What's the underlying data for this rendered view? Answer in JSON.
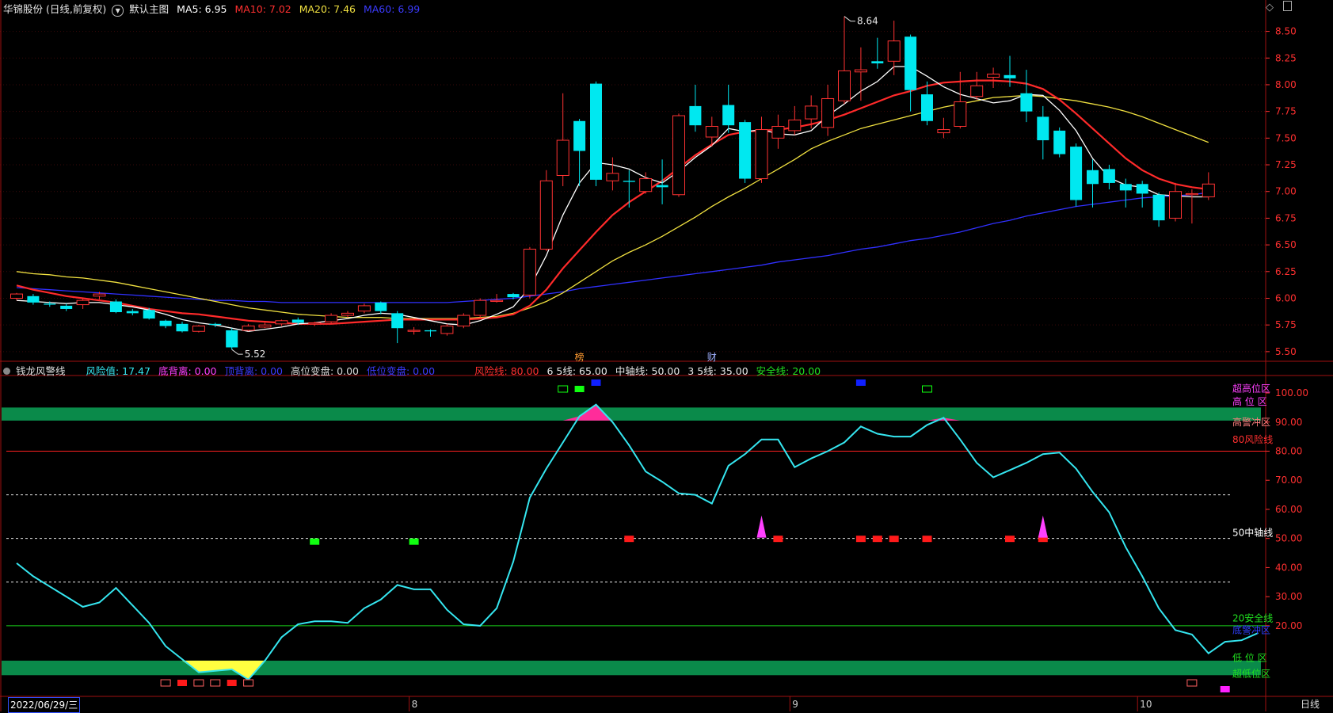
{
  "main_header": {
    "stock": "华锦股份 (日线,前复权)",
    "icon": "chevron-down-icon",
    "template": "默认主图",
    "ma5": "MA5: 6.95",
    "ma10": "MA10: 7.02",
    "ma20": "MA20: 7.46",
    "ma60": "MA60: 6.99",
    "ma_colors": {
      "ma5": "#ffffff",
      "ma10": "#ff2a2a",
      "ma20": "#f0e040",
      "ma60": "#3030ff"
    }
  },
  "window_icons": [
    "diamond-icon",
    "maximize-icon"
  ],
  "indicator_header": {
    "name": "钱龙风警线",
    "risk": "风险值: 17.47",
    "bottom_gap": "底背离: 0.00",
    "top_gap": "顶背离: 0.00",
    "high_turn": "高位变盘: 0.00",
    "low_turn": "低位变盘: 0.00",
    "risk_line": "风险线: 80.00",
    "line65": "6 5线: 65.00",
    "mid_line": "中轴线: 50.00",
    "line35": "3 5线: 35.00",
    "safe_line": "安全线: 20.00"
  },
  "colors": {
    "up": "#ff3232",
    "down": "#00e8f0",
    "risk_curve": "#35e6f0",
    "band": "#0a8a4a",
    "risk_red": "#ff2020",
    "safe_green": "#18d018",
    "axis_red": "#ff3030",
    "pink_fill": "#ff2c9a",
    "yellow_fill": "#ffff40"
  },
  "markers": {
    "bang": "榜",
    "cai": "财"
  },
  "bottom_bar": {
    "date": "2022/06/29/三",
    "period": "日线"
  },
  "zone_labels": [
    {
      "text": "超高位区",
      "color": "#ff40ff",
      "y": 101.5
    },
    {
      "text": "高 位 区",
      "color": "#ff40ff",
      "y": 97
    },
    {
      "text": "高警冲区",
      "color": "#ff8080",
      "y": 90
    },
    {
      "text": "80风险线",
      "color": "#ff3030",
      "y": 84
    },
    {
      "text": "50中轴线",
      "color": "#ffffff",
      "y": 52
    },
    {
      "text": "20安全线",
      "color": "#20e020",
      "y": 22.5
    },
    {
      "text": "底警冲区",
      "color": "#3040ff",
      "y": 18.5
    },
    {
      "text": "低 位 区",
      "color": "#20e020",
      "y": 9
    },
    {
      "text": "超低位区",
      "color": "#20e020",
      "y": 3.5
    }
  ],
  "chart_data": [
    {
      "type": "candlestick",
      "title": "华锦股份 (日线,前复权)",
      "price_ticks": [
        "8.50",
        "8.25",
        "8.00",
        "7.75",
        "7.50",
        "7.25",
        "7.00",
        "6.75",
        "6.50",
        "6.25",
        "6.00",
        "5.75",
        "5.50"
      ],
      "ylim": [
        5.41,
        8.66
      ],
      "month_ticks": [
        {
          "label": "8",
          "index": 24
        },
        {
          "label": "9",
          "index": 47
        },
        {
          "label": "10",
          "index": 68
        }
      ],
      "annotations": {
        "high": "8.64",
        "low": "5.52"
      },
      "candles": [
        [
          6.0,
          6.04,
          5.98,
          6.05
        ],
        [
          6.02,
          5.96,
          5.94,
          6.04
        ],
        [
          5.95,
          5.94,
          5.92,
          5.97
        ],
        [
          5.93,
          5.9,
          5.88,
          5.95
        ],
        [
          5.94,
          5.98,
          5.9,
          6.0
        ],
        [
          6.02,
          6.04,
          5.99,
          6.06
        ],
        [
          5.97,
          5.87,
          5.86,
          5.99
        ],
        [
          5.88,
          5.86,
          5.84,
          5.9
        ],
        [
          5.89,
          5.81,
          5.8,
          5.91
        ],
        [
          5.79,
          5.74,
          5.72,
          5.8
        ],
        [
          5.76,
          5.69,
          5.68,
          5.78
        ],
        [
          5.69,
          5.74,
          5.68,
          5.75
        ],
        [
          5.76,
          5.75,
          5.73,
          5.77
        ],
        [
          5.7,
          5.54,
          5.52,
          5.72
        ],
        [
          5.7,
          5.74,
          5.69,
          5.76
        ],
        [
          5.73,
          5.75,
          5.72,
          5.77
        ],
        [
          5.76,
          5.79,
          5.74,
          5.8
        ],
        [
          5.8,
          5.77,
          5.75,
          5.82
        ],
        [
          5.76,
          5.77,
          5.74,
          5.78
        ],
        [
          5.78,
          5.84,
          5.76,
          5.86
        ],
        [
          5.84,
          5.86,
          5.82,
          5.88
        ],
        [
          5.88,
          5.93,
          5.86,
          5.95
        ],
        [
          5.96,
          5.88,
          5.85,
          5.97
        ],
        [
          5.86,
          5.72,
          5.58,
          5.88
        ],
        [
          5.69,
          5.7,
          5.66,
          5.73
        ],
        [
          5.7,
          5.69,
          5.64,
          5.71
        ],
        [
          5.67,
          5.74,
          5.65,
          5.76
        ],
        [
          5.74,
          5.84,
          5.72,
          5.86
        ],
        [
          5.84,
          5.98,
          5.82,
          6.0
        ],
        [
          5.97,
          5.98,
          5.96,
          6.04
        ],
        [
          6.04,
          6.01,
          5.99,
          6.05
        ],
        [
          6.03,
          6.46,
          6.0,
          6.48
        ],
        [
          6.46,
          7.1,
          6.44,
          7.2
        ],
        [
          7.15,
          7.48,
          7.05,
          7.92
        ],
        [
          7.66,
          7.38,
          7.05,
          7.68
        ],
        [
          8.01,
          7.11,
          7.05,
          8.03
        ],
        [
          7.1,
          7.17,
          7.01,
          7.32
        ],
        [
          7.1,
          7.09,
          6.85,
          7.2
        ],
        [
          7.0,
          7.12,
          6.98,
          7.18
        ],
        [
          7.06,
          7.04,
          6.88,
          7.3
        ],
        [
          6.97,
          7.71,
          6.95,
          7.73
        ],
        [
          7.8,
          7.62,
          7.56,
          8.0
        ],
        [
          7.51,
          7.61,
          7.42,
          7.7
        ],
        [
          7.81,
          7.62,
          7.55,
          8.0
        ],
        [
          7.65,
          7.12,
          7.08,
          7.67
        ],
        [
          7.12,
          7.58,
          7.08,
          7.7
        ],
        [
          7.5,
          7.61,
          7.4,
          7.72
        ],
        [
          7.57,
          7.67,
          7.53,
          7.8
        ],
        [
          7.68,
          7.8,
          7.59,
          7.9
        ],
        [
          7.6,
          7.87,
          7.52,
          8.0
        ],
        [
          7.85,
          8.13,
          7.82,
          8.64
        ],
        [
          8.12,
          8.14,
          7.85,
          8.35
        ],
        [
          8.22,
          8.2,
          8.15,
          8.44
        ],
        [
          8.22,
          8.41,
          8.09,
          8.6
        ],
        [
          8.45,
          7.95,
          7.75,
          8.47
        ],
        [
          7.91,
          7.66,
          7.62,
          8.03
        ],
        [
          7.55,
          7.58,
          7.5,
          7.69
        ],
        [
          7.61,
          7.84,
          7.59,
          8.12
        ],
        [
          7.89,
          7.99,
          7.86,
          8.12
        ],
        [
          8.07,
          8.1,
          7.97,
          8.16
        ],
        [
          8.09,
          8.06,
          7.98,
          8.27
        ],
        [
          7.92,
          7.75,
          7.65,
          8.14
        ],
        [
          7.7,
          7.48,
          7.3,
          7.8
        ],
        [
          7.57,
          7.35,
          7.32,
          7.6
        ],
        [
          7.42,
          6.92,
          6.86,
          7.45
        ],
        [
          7.2,
          7.07,
          6.85,
          7.3
        ],
        [
          7.21,
          7.08,
          7.02,
          7.25
        ],
        [
          7.07,
          7.01,
          6.85,
          7.12
        ],
        [
          7.07,
          6.98,
          6.85,
          7.1
        ],
        [
          6.97,
          6.73,
          6.67,
          6.99
        ],
        [
          6.75,
          7.0,
          6.72,
          7.08
        ],
        [
          6.97,
          6.98,
          6.7,
          7.02
        ],
        [
          6.95,
          7.07,
          6.92,
          7.18
        ]
      ],
      "series": [
        {
          "name": "MA5",
          "values": [
            5.98,
            5.97,
            5.96,
            5.95,
            5.96,
            5.96,
            5.94,
            5.92,
            5.89,
            5.85,
            5.8,
            5.77,
            5.75,
            5.72,
            5.69,
            5.71,
            5.73,
            5.76,
            5.77,
            5.79,
            5.81,
            5.84,
            5.86,
            5.85,
            5.82,
            5.79,
            5.76,
            5.75,
            5.79,
            5.85,
            5.92,
            6.1,
            6.4,
            6.78,
            7.08,
            7.27,
            7.25,
            7.21,
            7.13,
            7.08,
            7.19,
            7.32,
            7.43,
            7.59,
            7.56,
            7.58,
            7.54,
            7.53,
            7.57,
            7.71,
            7.82,
            7.94,
            8.03,
            8.17,
            8.17,
            8.08,
            7.98,
            7.91,
            7.87,
            7.83,
            7.85,
            7.91,
            7.9,
            7.76,
            7.57,
            7.31,
            7.13,
            7.06,
            7.04,
            6.97,
            6.96,
            6.95,
            6.95
          ]
        },
        {
          "name": "MA10",
          "values": [
            6.12,
            6.08,
            6.05,
            6.02,
            6.0,
            5.98,
            5.96,
            5.93,
            5.9,
            5.88,
            5.86,
            5.85,
            5.83,
            5.81,
            5.79,
            5.78,
            5.77,
            5.76,
            5.76,
            5.76,
            5.77,
            5.78,
            5.79,
            5.8,
            5.8,
            5.8,
            5.8,
            5.8,
            5.81,
            5.82,
            5.85,
            5.93,
            6.08,
            6.28,
            6.45,
            6.62,
            6.78,
            6.9,
            7.0,
            7.1,
            7.22,
            7.34,
            7.44,
            7.53,
            7.56,
            7.57,
            7.58,
            7.6,
            7.63,
            7.67,
            7.72,
            7.78,
            7.84,
            7.9,
            7.94,
            7.99,
            8.02,
            8.03,
            8.04,
            8.04,
            8.03,
            8.01,
            7.96,
            7.86,
            7.73,
            7.59,
            7.45,
            7.31,
            7.2,
            7.12,
            7.07,
            7.04,
            7.02
          ]
        },
        {
          "name": "MA20",
          "values": [
            6.25,
            6.23,
            6.22,
            6.2,
            6.19,
            6.17,
            6.15,
            6.12,
            6.09,
            6.06,
            6.03,
            6.0,
            5.97,
            5.94,
            5.91,
            5.89,
            5.87,
            5.85,
            5.84,
            5.83,
            5.82,
            5.82,
            5.82,
            5.81,
            5.81,
            5.81,
            5.81,
            5.81,
            5.82,
            5.83,
            5.86,
            5.91,
            5.97,
            6.05,
            6.15,
            6.25,
            6.35,
            6.43,
            6.5,
            6.58,
            6.67,
            6.76,
            6.86,
            6.95,
            7.03,
            7.12,
            7.21,
            7.3,
            7.4,
            7.47,
            7.53,
            7.59,
            7.63,
            7.67,
            7.71,
            7.75,
            7.79,
            7.82,
            7.85,
            7.88,
            7.89,
            7.9,
            7.89,
            7.87,
            7.85,
            7.82,
            7.79,
            7.75,
            7.7,
            7.64,
            7.58,
            7.52,
            7.46
          ]
        },
        {
          "name": "MA60",
          "values": [
            6.1,
            6.09,
            6.08,
            6.07,
            6.06,
            6.05,
            6.04,
            6.03,
            6.02,
            6.01,
            6.0,
            5.99,
            5.98,
            5.98,
            5.97,
            5.97,
            5.96,
            5.96,
            5.96,
            5.96,
            5.96,
            5.96,
            5.96,
            5.96,
            5.96,
            5.96,
            5.96,
            5.97,
            5.98,
            5.99,
            6.0,
            6.02,
            6.04,
            6.06,
            6.09,
            6.11,
            6.13,
            6.15,
            6.17,
            6.19,
            6.21,
            6.23,
            6.25,
            6.27,
            6.29,
            6.31,
            6.34,
            6.36,
            6.38,
            6.4,
            6.43,
            6.46,
            6.48,
            6.51,
            6.54,
            6.56,
            6.59,
            6.62,
            6.66,
            6.7,
            6.73,
            6.77,
            6.8,
            6.83,
            6.86,
            6.88,
            6.9,
            6.92,
            6.94,
            6.95,
            6.96,
            6.97,
            6.99
          ]
        }
      ]
    },
    {
      "type": "line",
      "title": "钱龙风警线",
      "y_ticks": [
        "100.00",
        "90.00",
        "80.00",
        "70.00",
        "60.00",
        "50.00",
        "40.00",
        "30.00",
        "20.00"
      ],
      "ylim": [
        -4,
        106
      ],
      "series": [
        {
          "name": "风险值",
          "values": [
            41.5,
            37,
            33.5,
            30,
            26.5,
            28,
            33,
            27,
            21,
            13,
            8.5,
            4,
            4.5,
            5,
            1.5,
            8,
            16,
            20.5,
            21.5,
            21.5,
            21,
            26,
            29,
            34,
            32.5,
            32.5,
            25.5,
            20.5,
            20,
            26,
            42,
            64,
            74,
            83,
            92,
            96,
            90,
            82,
            73,
            69.5,
            65.5,
            65,
            62,
            75,
            79,
            84,
            84,
            74.5,
            77.5,
            80,
            83,
            88.5,
            86,
            85,
            85,
            89,
            91.5,
            84,
            76,
            71,
            73.5,
            76,
            79,
            79.5,
            74,
            66,
            59,
            47,
            37,
            26,
            18.5,
            17,
            10.5,
            14.5,
            15,
            17.5
          ]
        }
      ],
      "reference_lines": {
        "risk_line": 80,
        "line65": 65,
        "mid_line": 50,
        "line35": 35,
        "safe_line": 20
      },
      "bands": [
        [
          90.5,
          95
        ],
        [
          3,
          8
        ]
      ],
      "signals": {
        "red_squares": [
          37,
          46,
          51,
          52,
          53,
          55,
          60,
          62
        ],
        "green_squares": [
          18,
          24
        ],
        "pink_triangles": [
          45,
          62
        ],
        "top_green_outline": [
          33,
          55
        ],
        "top_green_filled": [
          34
        ],
        "top_blue_filled": [
          35,
          51
        ],
        "bottom_red_outline": [
          9,
          11,
          12,
          14,
          71
        ],
        "bottom_red_filled": [
          10,
          13
        ],
        "bottom_magenta": [
          73
        ]
      }
    }
  ]
}
